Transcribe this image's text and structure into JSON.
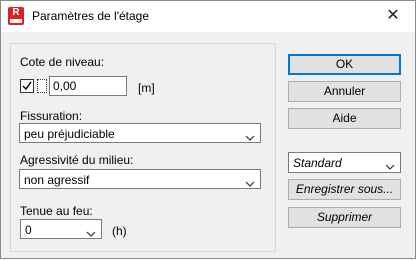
{
  "window": {
    "title": "Paramètres de l'étage",
    "app_icon_letter": "R",
    "close_glyph": "✕"
  },
  "form": {
    "cote_label": "Cote de niveau:",
    "cote_value": "0,00",
    "cote_unit": "[m]",
    "cote_checkbox_checked": true,
    "fissuration_label": "Fissuration:",
    "fissuration_value": "peu préjudiciable",
    "agressivite_label": "Agressivité du milieu:",
    "agressivite_value": "non agressif",
    "tenue_label": "Tenue au feu:",
    "tenue_value": "0",
    "tenue_unit": "(h)"
  },
  "buttons": {
    "ok": "OK",
    "annuler": "Annuler",
    "aide": "Aide",
    "standard": "Standard",
    "enregistrer": "Enregistrer sous...",
    "supprimer": "Supprimer"
  },
  "colors": {
    "accent": "#0078d7",
    "app_icon": "#e02020"
  }
}
